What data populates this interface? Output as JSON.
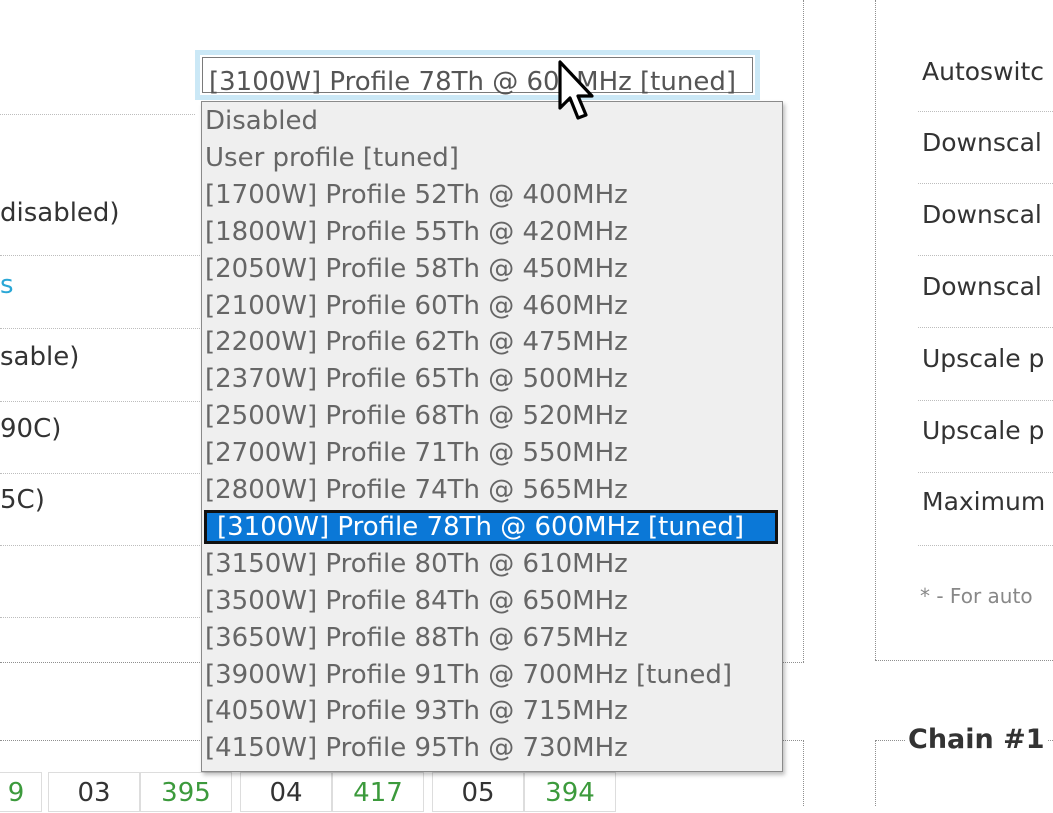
{
  "left_panel": {
    "rows": [
      {
        "text": " disabled)",
        "color": "#333333"
      },
      {
        "text": "s",
        "color": "#2aa7d6"
      },
      {
        "text": "sable)",
        "color": "#333333"
      },
      {
        "text": "90C)",
        "color": "#333333"
      },
      {
        "text": "5C)",
        "color": "#333333"
      }
    ]
  },
  "profile_select": {
    "selected_value": "[3100W] Profile 78Th @ 600MHz [tuned]",
    "options": [
      "Disabled",
      "User profile [tuned]",
      "[1700W] Profile 52Th @ 400MHz",
      "[1800W] Profile 55Th @ 420MHz",
      "[2050W] Profile 58Th @ 450MHz",
      "[2100W] Profile 60Th @ 460MHz",
      "[2200W] Profile 62Th @ 475MHz",
      "[2370W] Profile 65Th @ 500MHz",
      "[2500W] Profile 68Th @ 520MHz",
      "[2700W] Profile 71Th @ 550MHz",
      "[2800W] Profile 74Th @ 565MHz",
      "[3100W] Profile 78Th @ 600MHz [tuned]",
      "[3150W] Profile 80Th @ 610MHz",
      "[3500W] Profile 84Th @ 650MHz",
      "[3650W] Profile 88Th @ 675MHz",
      "[3900W] Profile 91Th @ 700MHz [tuned]",
      "[4050W] Profile 93Th @ 715MHz",
      "[4150W] Profile 95Th @ 730MHz"
    ],
    "highlighted_index": 11,
    "highlight_color": "#0b78d7"
  },
  "right_panel": {
    "rows": [
      "Autoswitc",
      "Downscal",
      "Downscal",
      "Downscal",
      "Upscale p",
      "Upscale p",
      "Maximum"
    ],
    "note": "* - For auto"
  },
  "chain": {
    "title": "Chain #1",
    "cells": [
      {
        "text": "9",
        "color": "green"
      },
      {
        "text": "03",
        "color": "dark"
      },
      {
        "text": "395",
        "color": "green"
      },
      {
        "text": "04",
        "color": "dark"
      },
      {
        "text": "417",
        "color": "green"
      },
      {
        "text": "05",
        "color": "dark"
      },
      {
        "text": "394",
        "color": "green"
      }
    ]
  }
}
